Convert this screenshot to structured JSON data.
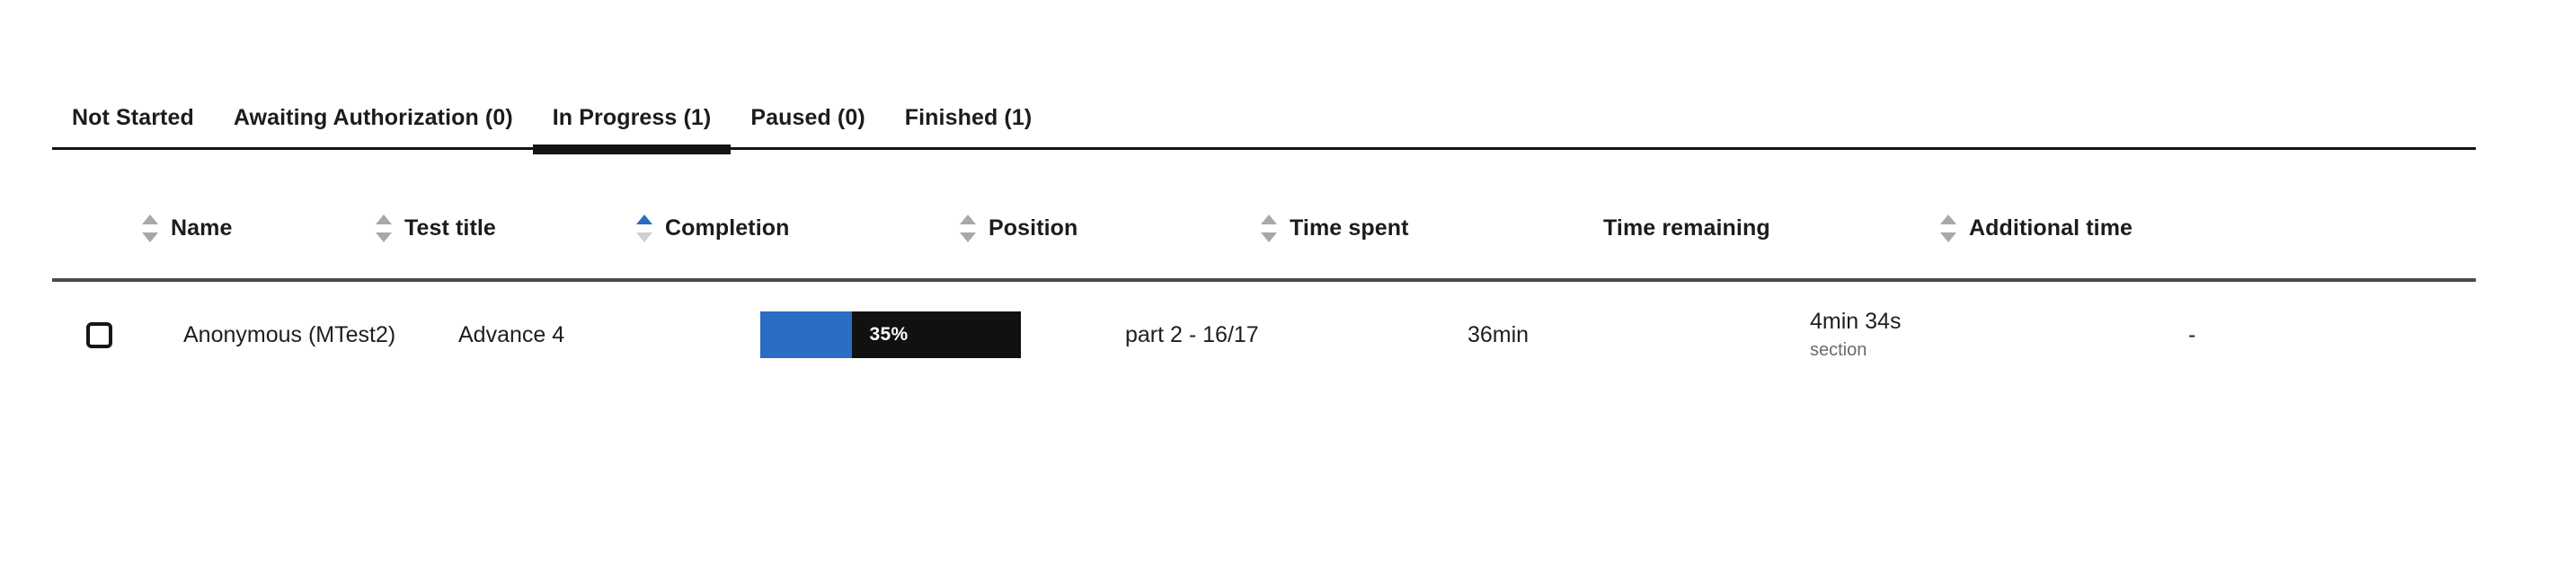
{
  "theme": {
    "accent_blue": "#2b6cc4",
    "bar_track": "#111111",
    "text_primary": "#1f1f1f",
    "text_muted": "#6b6b6b",
    "arrow_inactive": "#a8a8a8",
    "divider": "#4a4a4a",
    "tab_line": "#131313"
  },
  "tabs": [
    {
      "label": "Not Started",
      "active": false
    },
    {
      "label": "Awaiting Authorization (0)",
      "active": false
    },
    {
      "label": "In Progress (1)",
      "active": true
    },
    {
      "label": "Paused (0)",
      "active": false
    },
    {
      "label": "Finished (1)",
      "active": false
    }
  ],
  "table": {
    "columns": [
      {
        "key": "select",
        "label": "",
        "sortable": false,
        "sort": "none"
      },
      {
        "key": "name",
        "label": "Name",
        "sortable": true,
        "sort": "none"
      },
      {
        "key": "test_title",
        "label": "Test title",
        "sortable": true,
        "sort": "none"
      },
      {
        "key": "completion",
        "label": "Completion",
        "sortable": true,
        "sort": "asc"
      },
      {
        "key": "position",
        "label": "Position",
        "sortable": true,
        "sort": "none"
      },
      {
        "key": "time_spent",
        "label": "Time spent",
        "sortable": true,
        "sort": "none"
      },
      {
        "key": "time_remaining",
        "label": "Time remaining",
        "sortable": false,
        "sort": "none"
      },
      {
        "key": "additional_time",
        "label": "Additional time",
        "sortable": true,
        "sort": "none"
      }
    ],
    "rows": [
      {
        "selected": false,
        "name": "Anonymous (MTest2)",
        "test_title": "Advance 4",
        "completion_percent": 35,
        "completion_label": "35%",
        "position": "part 2 - 16/17",
        "time_spent": "36min",
        "time_remaining": "4min 34s",
        "time_remaining_scope": "section",
        "additional_time": "-"
      }
    ]
  }
}
